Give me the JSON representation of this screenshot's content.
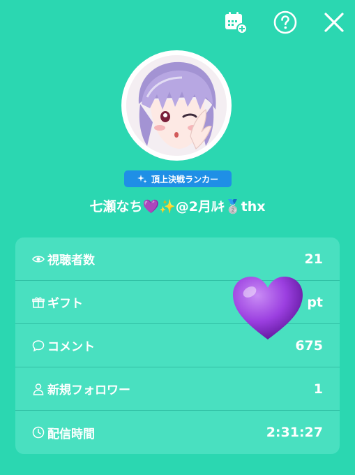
{
  "colors": {
    "background": "#2bd7b1",
    "panel": "#49e0c0",
    "badge": "#1f8fe6",
    "heart": "#9b3fe0"
  },
  "header": {
    "icons": [
      "calendar-add-icon",
      "help-icon",
      "close-icon"
    ]
  },
  "profile": {
    "rank_badge": "頂上決戦ランカー",
    "username": "七瀬なち💜✨@2月ﾙｷ🥈thx"
  },
  "stats": [
    {
      "icon": "eye-icon",
      "label": "視聴者数",
      "value": "21"
    },
    {
      "icon": "gift-icon",
      "label": "ギフト",
      "value": "pt"
    },
    {
      "icon": "comment-icon",
      "label": "コメント",
      "value": "675"
    },
    {
      "icon": "person-icon",
      "label": "新規フォロワー",
      "value": "1"
    },
    {
      "icon": "clock-icon",
      "label": "配信時間",
      "value": "2:31:27"
    }
  ]
}
